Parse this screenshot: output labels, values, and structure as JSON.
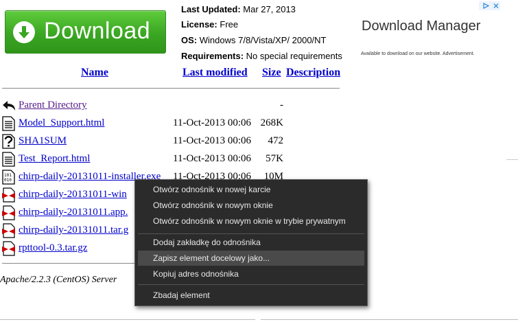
{
  "ad_button": {
    "label": "Download",
    "icon": "download-arrow-icon",
    "color": "#3aa622"
  },
  "info": {
    "last_updated_label": "Last Updated:",
    "last_updated_value": "Mar 27, 2013",
    "license_label": "License:",
    "license_value": "Free",
    "os_label": "OS:",
    "os_value": "Windows 7/8/Vista/XP/ 2000/NT",
    "req_label": "Requirements:",
    "req_value": "No special requirements"
  },
  "side_ad": {
    "title": "Download Manager",
    "subtitle": "Available to download on our website. Advertisement.",
    "choices_icon": "adchoices-icon",
    "close_icon": "close-icon"
  },
  "table": {
    "headers": {
      "name": "Name",
      "last_modified": "Last modified",
      "size": "Size",
      "description": "Description"
    },
    "rows": [
      {
        "icon": "back-arrow-icon",
        "name": "Parent Directory",
        "date": "",
        "size": "-"
      },
      {
        "icon": "text-file-icon",
        "name": "Model_Support.html",
        "date": "11-Oct-2013 00:06",
        "size": "268K"
      },
      {
        "icon": "unknown-file-icon",
        "name": "SHA1SUM",
        "date": "11-Oct-2013 00:06",
        "size": "472"
      },
      {
        "icon": "text-file-icon",
        "name": "Test_Report.html",
        "date": "11-Oct-2013 00:06",
        "size": "57K"
      },
      {
        "icon": "binary-file-icon",
        "name": "chirp-daily-20131011-installer.exe",
        "date": "11-Oct-2013 00:06",
        "size": "10M"
      },
      {
        "icon": "compressed-file-icon",
        "name": "chirp-daily-20131011-win",
        "date": "",
        "size": ""
      },
      {
        "icon": "compressed-file-icon",
        "name": "chirp-daily-20131011.app.",
        "date": "",
        "size": ""
      },
      {
        "icon": "compressed-file-icon",
        "name": "chirp-daily-20131011.tar.g",
        "date": "",
        "size": ""
      },
      {
        "icon": "compressed-file-icon",
        "name": "rpttool-0.3.tar.gz",
        "date": "",
        "size": ""
      }
    ]
  },
  "footer": "Apache/2.2.3 (CentOS) Server",
  "context_menu": {
    "items": [
      "Otwórz odnośnik w nowej karcie",
      "Otwórz odnośnik w nowym oknie",
      "Otwórz odnośnik w nowym oknie w trybie prywatnym",
      "Dodaj zakładkę do odnośnika",
      "Zapisz element docelowy jako...",
      "Kopiuj adres odnośnika",
      "Zbadaj element"
    ],
    "highlighted": "Zapisz element docelowy jako...",
    "bg_color": "#2b2b2b",
    "highlight_color": "#4a4a4a"
  }
}
